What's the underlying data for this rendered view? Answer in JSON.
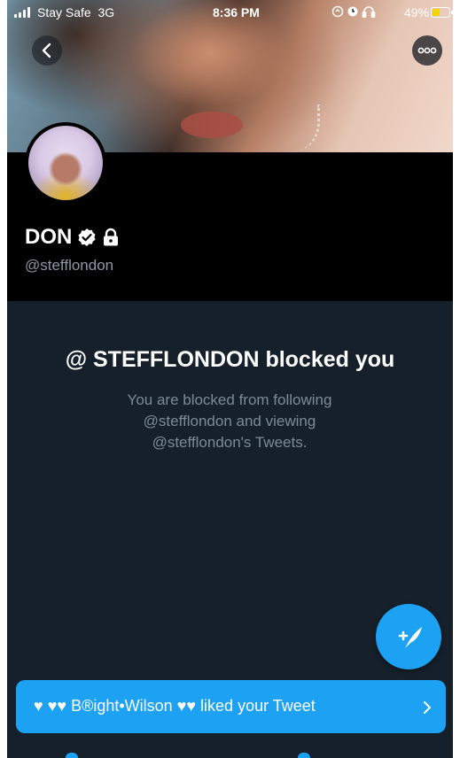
{
  "status_bar": {
    "carrier": "Stay Safe",
    "network": "3G",
    "time": "8:36 PM",
    "battery_percent": "49%",
    "battery_level": 0.49,
    "icons": [
      "signal-icon",
      "orientation-lock-icon",
      "alarm-icon",
      "headphones-icon",
      "battery-icon"
    ]
  },
  "nav": {
    "back_icon": "chevron-left-icon",
    "more_icon": "more-horizontal-icon"
  },
  "profile": {
    "display_name": "DON",
    "handle": "@stefflondon",
    "badges": [
      "verified-icon",
      "lock-icon"
    ]
  },
  "blocked": {
    "title": "@ STEFFLONDON blocked you",
    "description": "You are blocked from following @stefflondon and viewing @stefflondon's Tweets."
  },
  "fab": {
    "icon": "compose-tweet-icon"
  },
  "toast": {
    "text": "♥ ♥♥ B®ight•Wilson ♥♥ liked your Tweet",
    "icon": "chevron-right-icon"
  },
  "colors": {
    "accent": "#1da1f2",
    "background": "#15202b",
    "header": "#000000",
    "muted_text": "#8b98a5"
  }
}
